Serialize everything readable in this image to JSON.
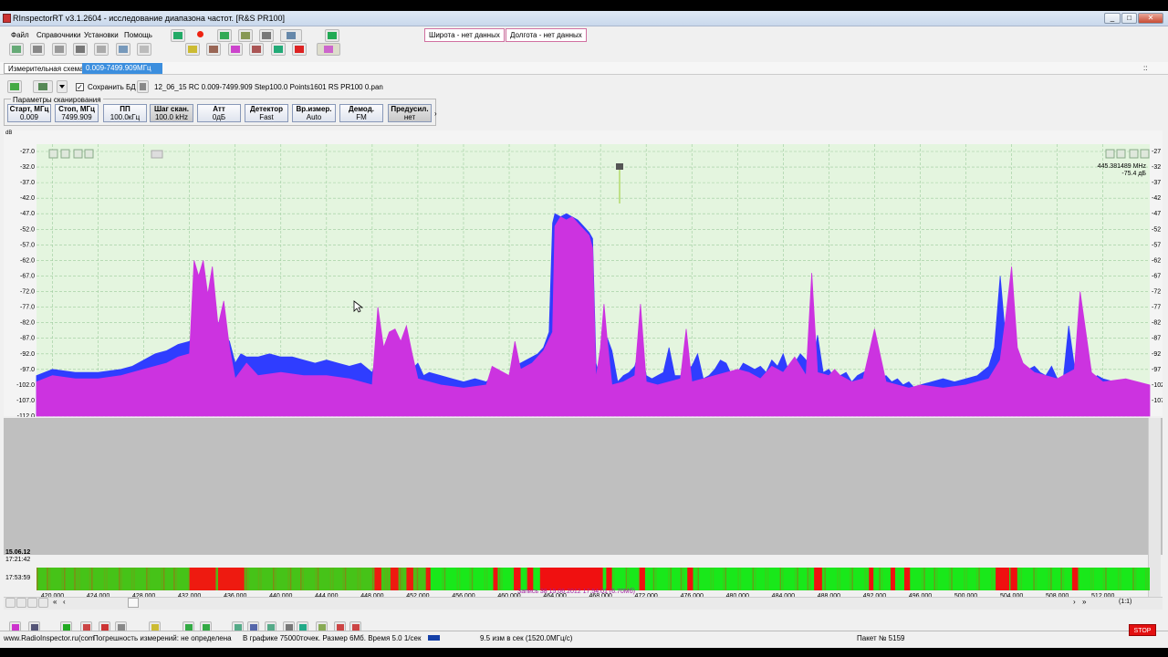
{
  "window": {
    "title": "RInspectorRT v3.1.2604 - исследование диапазона частот. [R&S PR100]",
    "buttons": [
      "_",
      "□",
      "✕"
    ]
  },
  "menu": {
    "items": [
      "Файл",
      "Справочники",
      "Установки",
      "Помощь"
    ]
  },
  "coords": {
    "lat": "Широта - нет данных",
    "lon": "Долгота - нет данных"
  },
  "tabs": {
    "scheme": "Измерительная схема",
    "range": "0.009-7499.909МГц",
    "right_marker": "::"
  },
  "toolbar2": {
    "save_db_label": "Сохранить БД",
    "save_db_checked": true,
    "filename": "12_06_15 RC 0.009-7499.909 Step100.0 Points1601 RS PR100 0.pan"
  },
  "scan_params": {
    "group_label": "Параметры сканирования",
    "items": [
      {
        "title": "Старт, МГц",
        "value": "0.009"
      },
      {
        "title": "Стоп, МГц",
        "value": "7499.909"
      },
      {
        "title": "ПП",
        "value": "100.0кГц"
      },
      {
        "title": "Шаг скан.",
        "value": "100.0 kHz"
      },
      {
        "title": "Атт",
        "value": "0дБ"
      },
      {
        "title": "Детектор",
        "value": "Fast"
      },
      {
        "title": "Вр.измер.",
        "value": "Auto"
      },
      {
        "title": "Демод.",
        "value": "FM"
      },
      {
        "title": "Предусил.",
        "value": "нет"
      }
    ]
  },
  "spectrum": {
    "unit_label": "dB",
    "marker_freq": "445.381489 MHz",
    "marker_level": "-75.4 дБ",
    "y_ticks": [
      "-27.0",
      "-32.0",
      "-37.0",
      "-42.0",
      "-47.0",
      "-52.0",
      "-57.0",
      "-62.0",
      "-67.0",
      "-72.0",
      "-77.0",
      "-82.0",
      "-87.0",
      "-92.0",
      "-97.0",
      "-102.0",
      "-107.0",
      "-112.0"
    ],
    "y_ticks_right": [
      "-27",
      "-32",
      "-37",
      "-42",
      "-47",
      "-52",
      "-57",
      "-62",
      "-67",
      "-72",
      "-77",
      "-82",
      "-87",
      "-92",
      "-97",
      "-102",
      "-107"
    ],
    "x_ticks": [
      "420.000",
      "424.000",
      "428.000",
      "432.000",
      "436.000",
      "440.000",
      "444.000",
      "448.000",
      "452.000",
      "456.000",
      "460.000",
      "464.000",
      "468.000",
      "472.000",
      "476.000",
      "480.000",
      "484.000",
      "488.000",
      "492.000",
      "496.000",
      "500.000",
      "504.000",
      "508.000",
      "512.000"
    ],
    "colors": {
      "plot_bg": "#e4f5df",
      "maxhold": "#2f3dff",
      "current": "#cc33e0",
      "grid": "#9ccc9c"
    }
  },
  "chart_data": {
    "type": "area",
    "xlabel": "",
    "ylabel": "",
    "xlim": [
      418.6,
      516.1
    ],
    "ylim": [
      -112,
      -27
    ],
    "series": [
      {
        "values_x": [
          418.6,
          420,
          422,
          424,
          426,
          427,
          428,
          429,
          430,
          431,
          432,
          432.4,
          432.8,
          433.2,
          433.6,
          434,
          434.5,
          435,
          435.5,
          436,
          436.5,
          437,
          438,
          439,
          440,
          441,
          442,
          443,
          444,
          445,
          446,
          447,
          448,
          448.5,
          449,
          449.5,
          450,
          450.5,
          451,
          451.5,
          452,
          452.5,
          453,
          454,
          455,
          456,
          457,
          458,
          458.5,
          459,
          459.5,
          460,
          460.5,
          461,
          461.5,
          462,
          462.5,
          463,
          463.5,
          463.8,
          464,
          464.5,
          465,
          465.5,
          466,
          466.5,
          467,
          467.3,
          467.6,
          468,
          468.3,
          468.6,
          469,
          469.5,
          470,
          470.5,
          471,
          471.5,
          472,
          472.5,
          473,
          473.5,
          474,
          474.5,
          475,
          475.5,
          476,
          476.5,
          477,
          477.5,
          478,
          478.5,
          479,
          479.5,
          480,
          480.5,
          481,
          481.5,
          482,
          482.5,
          483,
          483.5,
          484,
          484.5,
          485,
          485.5,
          486,
          486.5,
          487,
          487.5,
          488,
          488.5,
          489,
          489.5,
          490,
          490.5,
          491,
          491.5,
          492,
          492.5,
          493,
          493.5,
          494,
          494.5,
          495,
          495.5,
          496,
          497,
          498,
          499,
          500,
          501,
          502,
          502.5,
          503,
          503.5,
          504,
          504.5,
          505,
          505.5,
          506,
          506.5,
          507,
          507.5,
          508,
          508.5,
          509,
          509.5,
          510,
          510.5,
          511,
          511.5,
          512,
          513,
          514,
          515,
          516.1
        ],
        "values_y": [
          -99,
          -97,
          -98,
          -98,
          -97,
          -96,
          -94,
          -92,
          -91,
          -89,
          -88,
          -87,
          -85,
          -84,
          -86,
          -84,
          -82,
          -85,
          -88,
          -95,
          -92,
          -93,
          -93,
          -92,
          -93,
          -93,
          -94,
          -95,
          -94,
          -95,
          -96,
          -95,
          -98,
          -92,
          -94,
          -93,
          -95,
          -94,
          -93,
          -97,
          -95,
          -99,
          -98,
          -99,
          -100,
          -101,
          -100,
          -101,
          -99,
          -97,
          -100,
          -99,
          -96,
          -95,
          -94,
          -93,
          -92,
          -90,
          -85,
          -50,
          -47,
          -48,
          -47,
          -48,
          -49,
          -51,
          -53,
          -55,
          -95,
          -101,
          -89,
          -87,
          -91,
          -101,
          -99,
          -98,
          -96,
          -89,
          -99,
          -100,
          -99,
          -98,
          -90,
          -99,
          -99,
          -97,
          -96,
          -92,
          -100,
          -99,
          -97,
          -94,
          -95,
          -99,
          -98,
          -95,
          -96,
          -97,
          -96,
          -98,
          -94,
          -96,
          -92,
          -98,
          -95,
          -92,
          -94,
          -99,
          -86,
          -98,
          -97,
          -100,
          -99,
          -98,
          -101,
          -99,
          -98,
          -97,
          -102,
          -100,
          -99,
          -101,
          -100,
          -102,
          -101,
          -103,
          -102,
          -101,
          -100,
          -101,
          -100,
          -99,
          -96,
          -90,
          -67,
          -88,
          -93,
          -96,
          -95,
          -97,
          -96,
          -98,
          -99,
          -96,
          -100,
          -101,
          -83,
          -96,
          -99,
          -100,
          -101,
          -99,
          -100,
          -101,
          -102,
          -101
        ],
        "name": ""
      },
      {
        "values_x": [
          418.6,
          420,
          422,
          424,
          426,
          428,
          430,
          431,
          432,
          432.4,
          432.8,
          433.2,
          433.6,
          434,
          434.5,
          435,
          435.5,
          436,
          437,
          438,
          440,
          442,
          444,
          446,
          448,
          448.5,
          449,
          449.5,
          450,
          450.5,
          451,
          451.5,
          452,
          453,
          454,
          456,
          458,
          458.5,
          459,
          460,
          460.5,
          461,
          461.5,
          462,
          462.5,
          463,
          463.8,
          464,
          464.5,
          465,
          465.5,
          466,
          467,
          467.3,
          467.6,
          468,
          468.3,
          468.6,
          469,
          470,
          471,
          471.5,
          472,
          473,
          474,
          475,
          475.5,
          476,
          477,
          478,
          479,
          480,
          481,
          482,
          483,
          484,
          485,
          486,
          486.5,
          487,
          488,
          488.5,
          489,
          490,
          491,
          492,
          493,
          494,
          495,
          496,
          498,
          500,
          502,
          503,
          503.5,
          504,
          504.5,
          505,
          506,
          507,
          508,
          509,
          509.5,
          510,
          511,
          512,
          514,
          516.1
        ],
        "values_y": [
          -101,
          -99,
          -100,
          -100,
          -99,
          -97,
          -95,
          -93,
          -92,
          -62,
          -67,
          -62,
          -73,
          -64,
          -83,
          -75,
          -90,
          -100,
          -95,
          -99,
          -98,
          -99,
          -99,
          -100,
          -102,
          -77,
          -90,
          -85,
          -84,
          -88,
          -83,
          -92,
          -100,
          -101,
          -102,
          -103,
          -102,
          -96,
          -97,
          -99,
          -88,
          -97,
          -96,
          -95,
          -93,
          -91,
          -85,
          -51,
          -48,
          -49,
          -48,
          -50,
          -54,
          -58,
          -100,
          -90,
          -76,
          -88,
          -102,
          -101,
          -99,
          -76,
          -101,
          -102,
          -101,
          -100,
          -84,
          -101,
          -100,
          -99,
          -98,
          -97,
          -98,
          -100,
          -96,
          -98,
          -93,
          -99,
          -66,
          -98,
          -99,
          -97,
          -99,
          -101,
          -100,
          -84,
          -101,
          -102,
          -103,
          -102,
          -103,
          -102,
          -100,
          -94,
          -80,
          -64,
          -90,
          -95,
          -98,
          -99,
          -100,
          -98,
          -97,
          -72,
          -98,
          -101,
          -100,
          -102,
          -102
        ],
        "name": ""
      }
    ]
  },
  "waterfall": {
    "time_top": "15.06.12",
    "time_mid": "17:21:42",
    "time_bottom": "17:53:59",
    "record_label": "Запись 38 15.06.2012 17:54:01 (6.70Мб)",
    "scale": "(1:1)",
    "red_bands": [
      [
        432.0,
        434.3
      ],
      [
        434.5,
        436.8
      ],
      [
        448.2,
        448.8
      ],
      [
        449.6,
        450.3
      ],
      [
        451.0,
        451.6
      ],
      [
        452.7,
        453.1
      ],
      [
        458.6,
        459.0
      ],
      [
        460.4,
        461.0
      ],
      [
        461.6,
        462.1
      ],
      [
        462.7,
        468.2
      ],
      [
        468.5,
        469.0
      ],
      [
        471.4,
        471.9
      ],
      [
        475.6,
        476.1
      ],
      [
        486.7,
        487.4
      ],
      [
        491.5,
        491.9
      ],
      [
        493.4,
        493.8
      ],
      [
        494.6,
        495.1
      ],
      [
        502.6,
        503.8
      ],
      [
        503.9,
        504.5
      ],
      [
        509.3,
        509.8
      ]
    ]
  },
  "statusbar": {
    "site": "www.RadioInspector.ru(com",
    "accuracy": "Погрешность измерений: не определена",
    "points": "В графике 75000точек. Размер 6Мб. Время 5.0 1/сек",
    "rate": "9.5 изм в сек (1520.0МГц/с)",
    "packet": "Пакет № 5159",
    "stop": "STOP"
  }
}
